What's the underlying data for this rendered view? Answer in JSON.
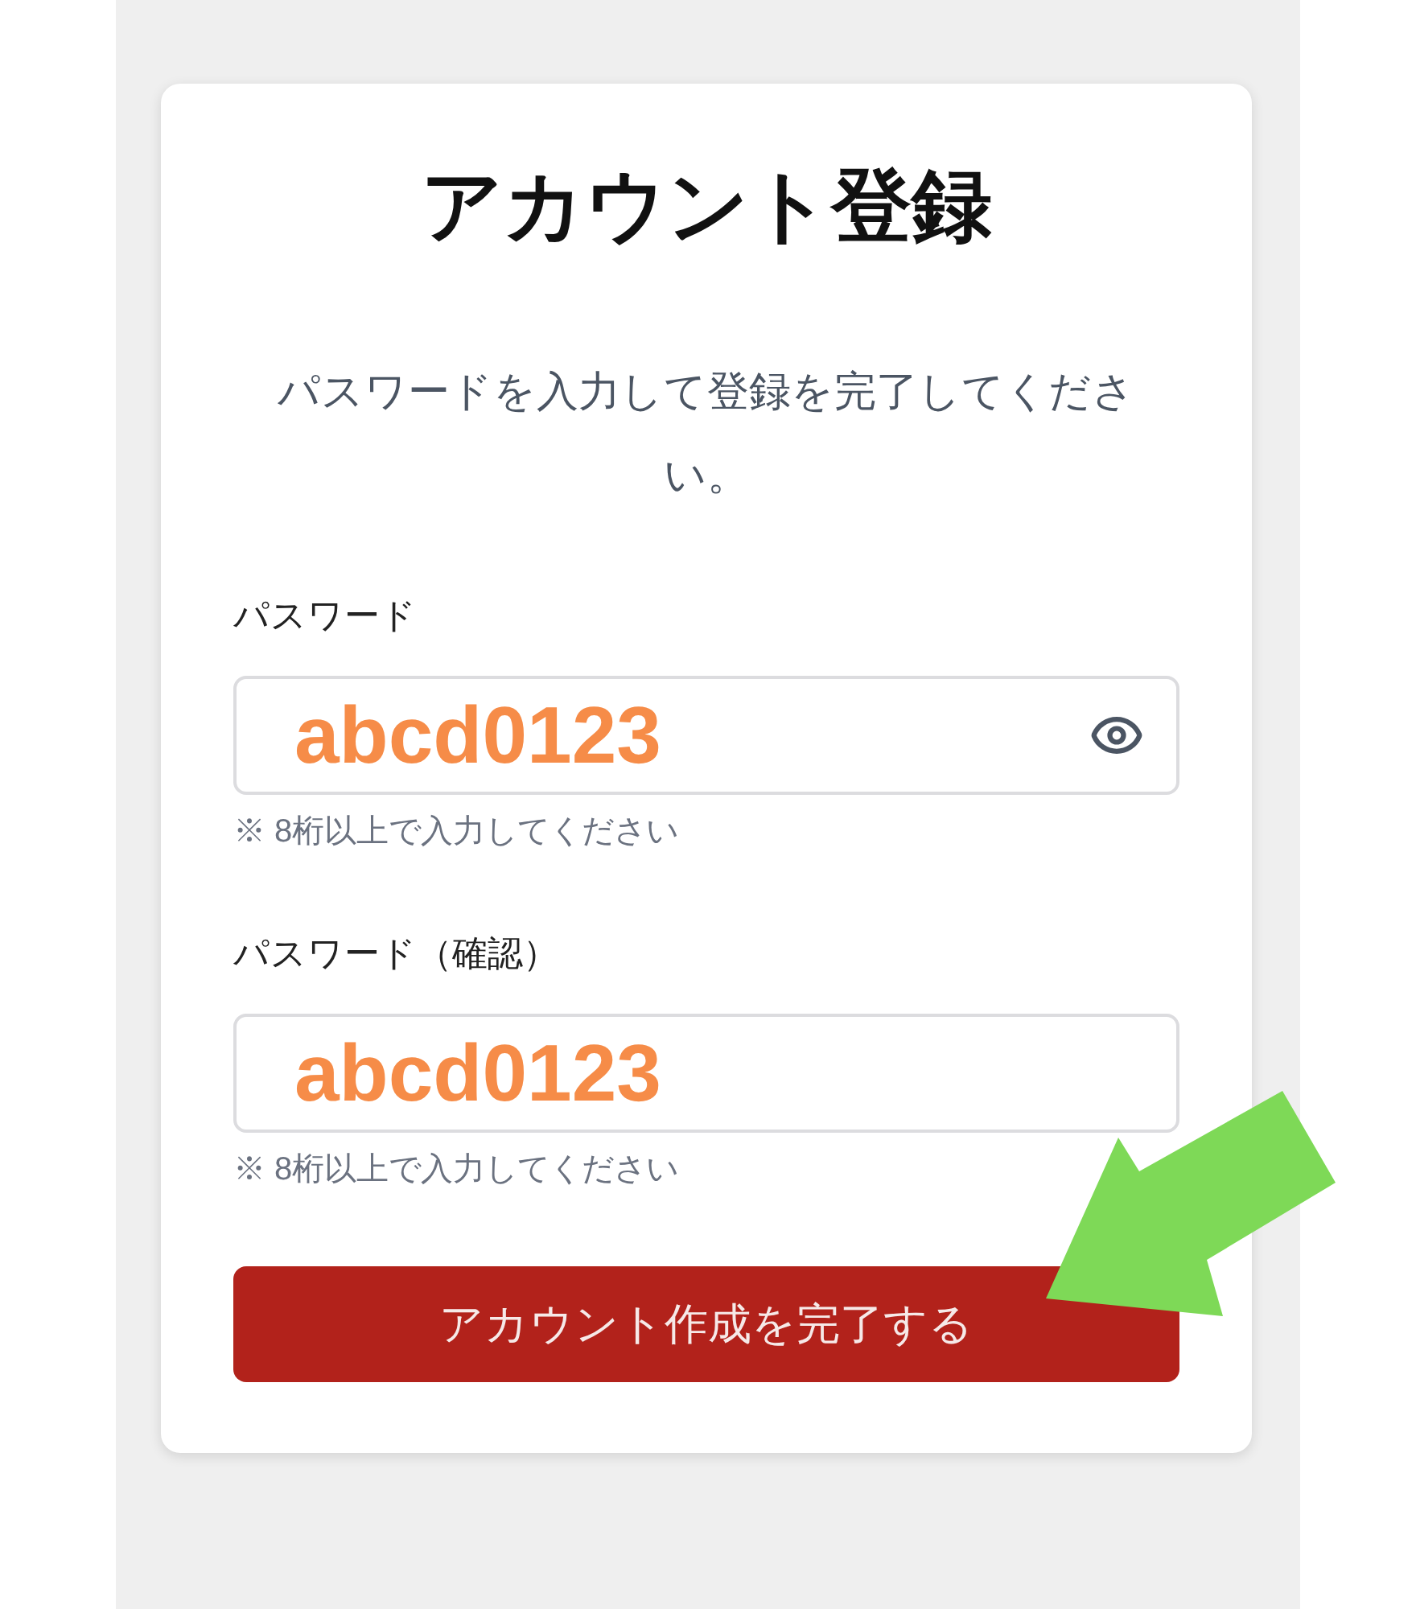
{
  "page": {
    "title": "アカウント登録",
    "description": "パスワードを入力して登録を完了してください。",
    "fields": [
      {
        "label": "パスワード",
        "value": "abcd0123",
        "hint": "※ 8桁以上で入力してください",
        "reveal_toggle": true
      },
      {
        "label": "パスワード（確認）",
        "value": "abcd0123",
        "hint": "※ 8桁以上で入力してください",
        "reveal_toggle": false
      }
    ],
    "submit_button": "アカウント作成を完了する"
  }
}
